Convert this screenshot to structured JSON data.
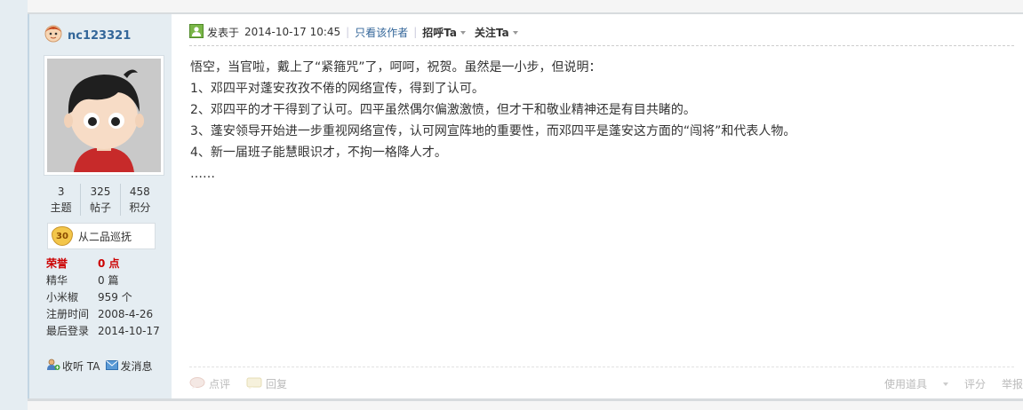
{
  "user": {
    "username": "nc123321",
    "stats": [
      {
        "value": "3",
        "label": "主题"
      },
      {
        "value": "325",
        "label": "帖子"
      },
      {
        "value": "458",
        "label": "积分"
      }
    ],
    "rank": {
      "level": "30",
      "title": "从二品巡抚"
    },
    "info": [
      {
        "label": "荣誉",
        "value": "0 点"
      },
      {
        "label": "精华",
        "value": "0 篇"
      },
      {
        "label": "小米椒",
        "value": "959 个"
      },
      {
        "label": "注册时间",
        "value": "2008-4-26"
      },
      {
        "label": "最后登录",
        "value": "2014-10-17"
      }
    ],
    "actions": {
      "follow": "收听 TA",
      "message": "发消息"
    }
  },
  "post": {
    "posted_prefix": "发表于",
    "posted_time": "2014-10-17 10:45",
    "only_author": "只看该作者",
    "greet": "招呼Ta",
    "follow": "关注Ta",
    "body": [
      "悟空，当官啦，戴上了“紧箍咒”了，呵呵，祝贺。虽然是一小步，但说明：",
      "1、邓四平对蓬安孜孜不倦的网络宣传，得到了认可。",
      "2、邓四平的才干得到了认可。四平虽然偶尔偏激激愤，但才干和敬业精神还是有目共睹的。",
      "3、蓬安领导开始进一步重视网络宣传，认可网宣阵地的重要性，而邓四平是蓬安这方面的“闯将”和代表人物。",
      "4、新一届班子能慧眼识才，不拘一格降人才。",
      "……"
    ],
    "footer": {
      "rate": "点评",
      "reply": "回复",
      "tools": "使用道具",
      "score": "评分",
      "report": "举报"
    }
  },
  "colors": {
    "link": "#336699",
    "honor": "#cc0000",
    "sidebar_bg": "#e5edf2",
    "main_bg": "#ffffff"
  }
}
